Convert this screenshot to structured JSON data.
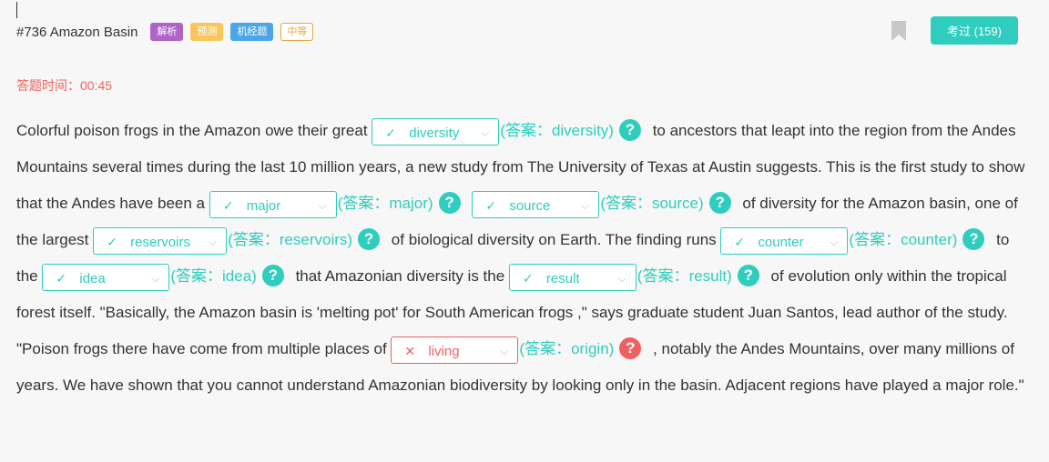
{
  "header": {
    "question_title": "#736 Amazon Basin",
    "tags": [
      "解析",
      "预测",
      "机经题"
    ],
    "level": "中等",
    "done_button": "考过 (159)"
  },
  "timer": "答题时间：00:45",
  "colors": {
    "accent": "#2ecdbd",
    "error": "#f06060",
    "tag_purple": "#b063c9",
    "tag_yellow": "#f7c75b",
    "tag_blue": "#4aa6e6",
    "level": "#e8a33d"
  },
  "icons": {
    "bookmark": "bookmark-icon",
    "correct": "check-icon",
    "wrong": "cross-icon",
    "help": "question-icon",
    "dropdown": "chevron-down-icon"
  },
  "passage": {
    "t0": "Colorful poison frogs in the Amazon owe their great ",
    "t1": " to ancestors that leapt into the region from the Andes Mountains several times during the last 10 million years, a new study from The University of Texas at Austin suggests. This is the first study to show that the Andes have been a ",
    "t2": " ",
    "t3": " of diversity for the Amazon basin, one of the largest ",
    "t4": " of biological diversity on Earth. The finding runs ",
    "t5": " to the ",
    "t6": " that Amazonian diversity is the ",
    "t7": " of evolution only within the tropical forest itself. \"Basically, the Amazon basin is 'melting pot' for South American frogs ,\" says graduate student Juan Santos, lead author of the study. \"Poison frogs there have come from multiple places of ",
    "t8": " , notably the Andes Mountains, over many millions of years. We have shown that you cannot understand Amazonian biodiversity by looking only in the basin. Adjacent regions have played a major role.\""
  },
  "blanks": [
    {
      "selected": "diversity",
      "answer": "(答案：diversity)",
      "correct": true
    },
    {
      "selected": "major",
      "answer": "(答案：major)",
      "correct": true
    },
    {
      "selected": "source",
      "answer": "(答案：source)",
      "correct": true
    },
    {
      "selected": "reservoirs",
      "answer": "(答案：reservoirs)",
      "correct": true
    },
    {
      "selected": "counter",
      "answer": "(答案：counter)",
      "correct": true
    },
    {
      "selected": "idea",
      "answer": "(答案：idea)",
      "correct": true
    },
    {
      "selected": "result",
      "answer": "(答案：result)",
      "correct": true
    },
    {
      "selected": "living",
      "answer": "(答案：origin)",
      "correct": false
    }
  ],
  "mark_correct": "✓",
  "mark_wrong": "✕",
  "help_glyph": "?",
  "caret_glyph": "⌵"
}
